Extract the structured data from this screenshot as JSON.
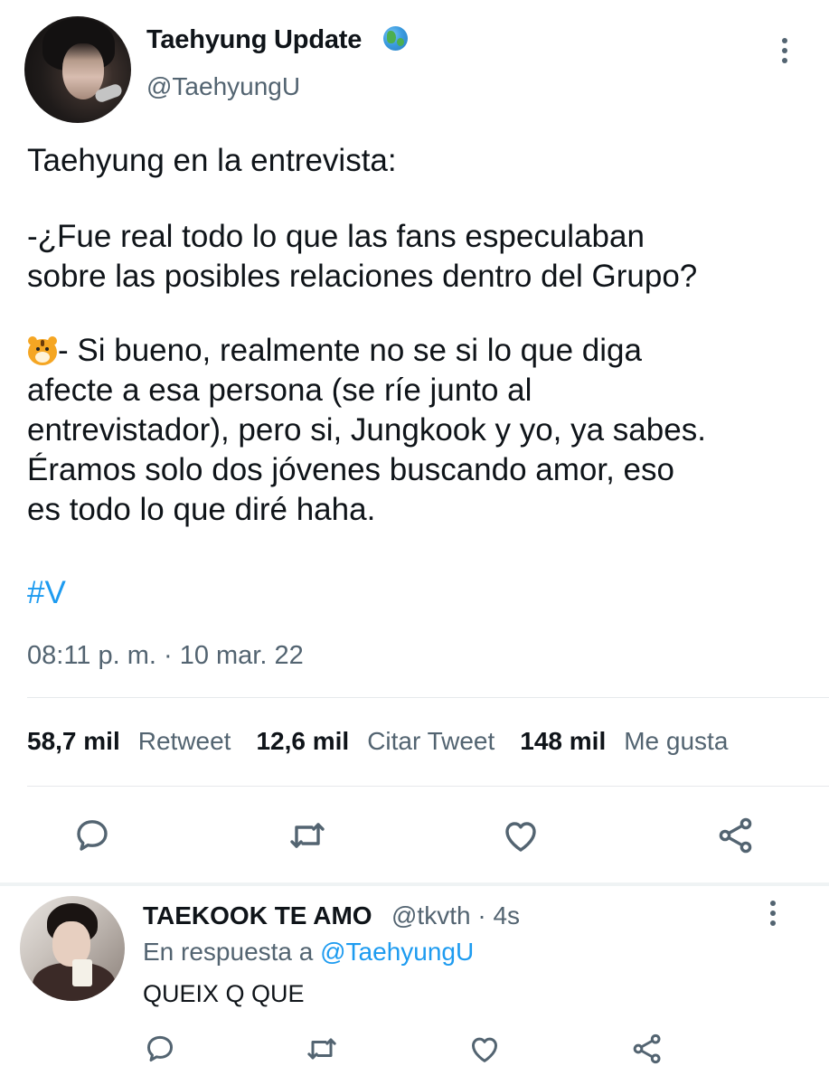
{
  "tweet": {
    "author_name": "Taehyung Update",
    "author_badge_icon": "globe-emoji-icon",
    "handle": "@TaehyungU",
    "paragraphs": [
      "Taehyung en la entrevista:",
      "-¿Fue real todo lo que las fans especulaban\nsobre las posibles relaciones dentro del Grupo?",
      "- Si bueno, realmente no se si lo que diga\nafecte a esa persona (se ríe junto al\nentrevistador), pero si, Jungkook y yo, ya sabes.\nÉramos solo dos jóvenes buscando amor, eso\nes todo lo que diré haha."
    ],
    "paragraph3_emoji_icon": "tiger-face-icon",
    "hashtag": "#V",
    "timestamp": "08:11 p. m. · 10 mar. 22",
    "stats": {
      "retweets_count": "58,7 mil",
      "retweets_label": "Retweet",
      "quotes_count": "12,6 mil",
      "quotes_label": "Citar Tweet",
      "likes_count": "148 mil",
      "likes_label": "Me gusta"
    },
    "actions": [
      "reply-icon",
      "retweet-icon",
      "like-icon",
      "share-icon"
    ]
  },
  "reply": {
    "author_name": "TAEKOOK TE AMO",
    "handle_time": "@tkvth · 4s",
    "in_reply_prefix": "En respuesta a ",
    "in_reply_mention": "@TaehyungU",
    "text": "QUEIX Q QUE",
    "actions": [
      "reply-icon",
      "retweet-icon",
      "like-icon",
      "share-icon"
    ]
  },
  "colors": {
    "link": "#1d9bf0",
    "secondary_text": "#536471",
    "primary_text": "#0f1419",
    "divider": "#e6e9ec"
  }
}
